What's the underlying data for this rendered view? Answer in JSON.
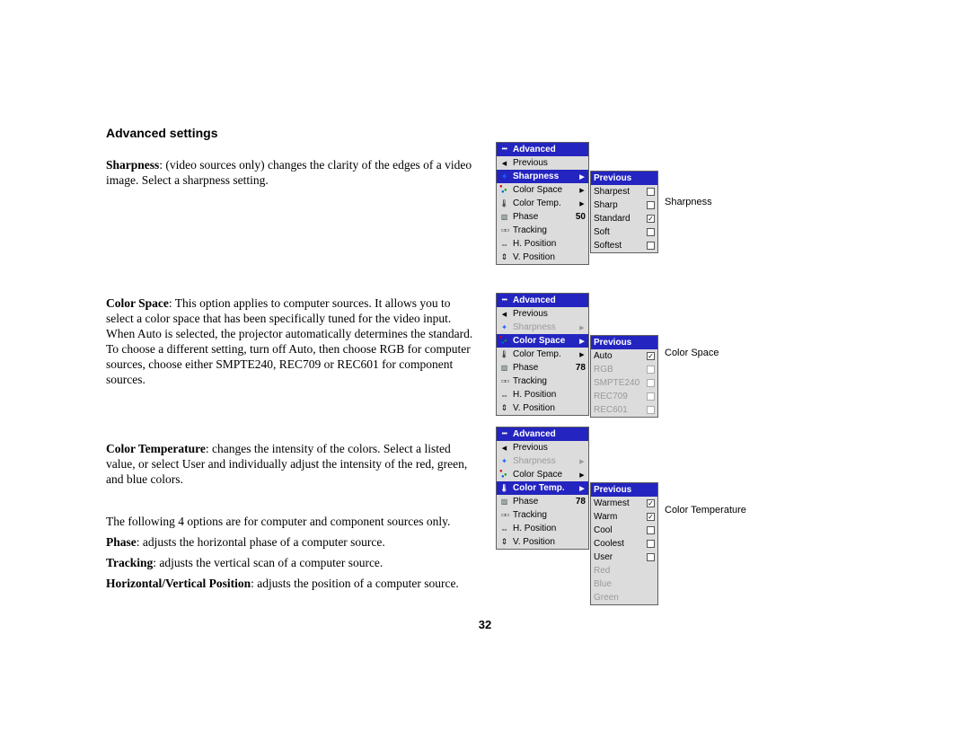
{
  "heading": "Advanced settings",
  "p_sharpness_bold": "Sharpness",
  "p_sharpness_rest": ": (video sources only) changes the clarity of the edges of a video image. Select a sharpness setting.",
  "p_colorspace_bold": "Color Space",
  "p_colorspace_rest": ": This option applies to computer sources. It allows you to select a color space that has been specifically tuned for the video input. When Auto is selected, the projector automatically determines the standard. To choose a different setting, turn off Auto, then choose RGB for computer sources, choose either SMPTE240, REC709 or REC601 for component sources.",
  "p_colortemp_bold": "Color Temperature",
  "p_colortemp_rest": ": changes the intensity of the colors. Select a listed value, or select User and individually adjust the intensity of the red, green, and blue colors.",
  "p_four": "The following 4 options are for computer and component sources only.",
  "p_phase_bold": "Phase",
  "p_phase_rest": ": adjusts the horizontal phase of a computer source.",
  "p_tracking_bold": "Tracking",
  "p_tracking_rest": ": adjusts the vertical scan of a computer source.",
  "p_hv_bold": "Horizontal/Vertical Position",
  "p_hv_rest": ": adjusts the position of a computer source.",
  "page_number": "32",
  "cap_sharp": "Sharpness",
  "cap_cspace": "Color Space",
  "cap_ctemp": "Color Temperature",
  "menu": {
    "advanced": "Advanced",
    "previous": "Previous",
    "sharpness": "Sharpness",
    "colorspace": "Color Space",
    "colortemp": "Color Temp.",
    "phase": "Phase",
    "tracking": "Tracking",
    "hpos": "H. Position",
    "vpos": "V. Position",
    "phase_val1": "50",
    "phase_val2": "78",
    "phase_val3": "78"
  },
  "sub_sharp": {
    "previous": "Previous",
    "sharpest": "Sharpest",
    "sharp": "Sharp",
    "standard": "Standard",
    "soft": "Soft",
    "softest": "Softest"
  },
  "sub_cspace": {
    "previous": "Previous",
    "auto": "Auto",
    "rgb": "RGB",
    "smpte240": "SMPTE240",
    "rec709": "REC709",
    "rec601": "REC601"
  },
  "sub_ctemp": {
    "previous": "Previous",
    "warmest": "Warmest",
    "warm": "Warm",
    "cool": "Cool",
    "coolest": "Coolest",
    "user": "User",
    "red": "Red",
    "blue": "Blue",
    "green": "Green"
  }
}
